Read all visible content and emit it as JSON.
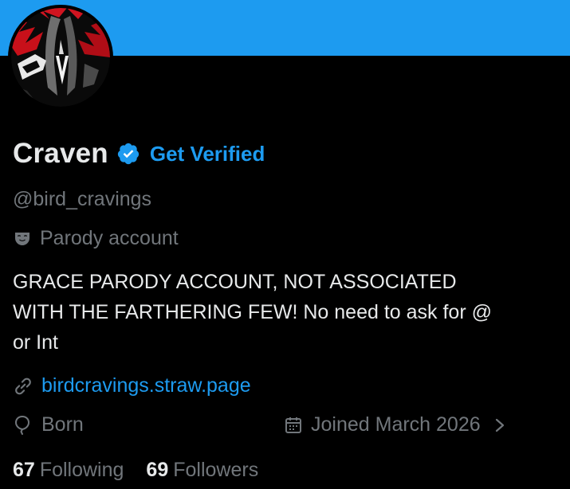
{
  "profile": {
    "display_name": "Craven",
    "get_verified_label": "Get Verified",
    "handle": "@bird_cravings",
    "parody_label": "Parody account",
    "bio_lines": [
      "GRACE PARODY ACCOUNT, NOT ASSOCIATED",
      "WITH THE FARTHERING FEW! No need to ask for @",
      "or Int"
    ],
    "website": "birdcravings.straw.page",
    "born_label": "Born",
    "joined_label": "Joined March 2026",
    "following_count": "67",
    "following_label": "Following",
    "followers_count": "69",
    "followers_label": "Followers"
  },
  "icons": {
    "verified": "verified-badge-icon",
    "parody": "theater-mask-icon",
    "link": "link-icon",
    "born": "balloon-icon",
    "joined": "calendar-icon",
    "chevron": "chevron-right-icon"
  },
  "colors": {
    "banner": "#1d9bf0",
    "background": "#000000",
    "accent": "#1d9bf0",
    "primary_text": "#e7e9ea",
    "secondary_text": "#71767b",
    "avatar_red": "#c8101a"
  }
}
